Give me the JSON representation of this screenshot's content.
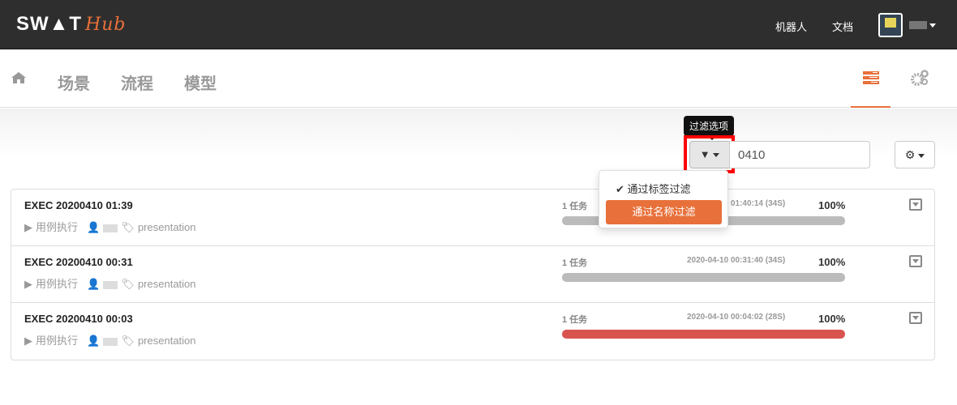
{
  "header": {
    "logo_main": "SW▲T",
    "logo_sub": "Hub",
    "links": [
      "机器人",
      "文档"
    ]
  },
  "nav": {
    "items": [
      "场景",
      "流程",
      "模型"
    ]
  },
  "toolbar": {
    "tooltip": "过滤选项",
    "search_value": "0410"
  },
  "filter_menu": {
    "items": [
      "通过标签过滤",
      "通过名称过滤"
    ],
    "checked": 0,
    "highlighted": 1
  },
  "colors": {
    "accent": "#e8703a",
    "bar_done": "#bbbbbb",
    "bar_fail": "#d9534f"
  },
  "executions": [
    {
      "title": "EXEC 20200410 01:39",
      "type": "用例执行",
      "tag": "presentation",
      "tasks": "1 任务",
      "time": "2020-04-10 01:40:14 (34S)",
      "percent": "100%",
      "progress": 100,
      "status_color": "#bbbbbb"
    },
    {
      "title": "EXEC 20200410 00:31",
      "type": "用例执行",
      "tag": "presentation",
      "tasks": "1 任务",
      "time": "2020-04-10 00:31:40 (34S)",
      "percent": "100%",
      "progress": 100,
      "status_color": "#bbbbbb"
    },
    {
      "title": "EXEC 20200410 00:03",
      "type": "用例执行",
      "tag": "presentation",
      "tasks": "1 任务",
      "time": "2020-04-10 00:04:02 (28S)",
      "percent": "100%",
      "progress": 100,
      "status_color": "#d9534f"
    }
  ]
}
